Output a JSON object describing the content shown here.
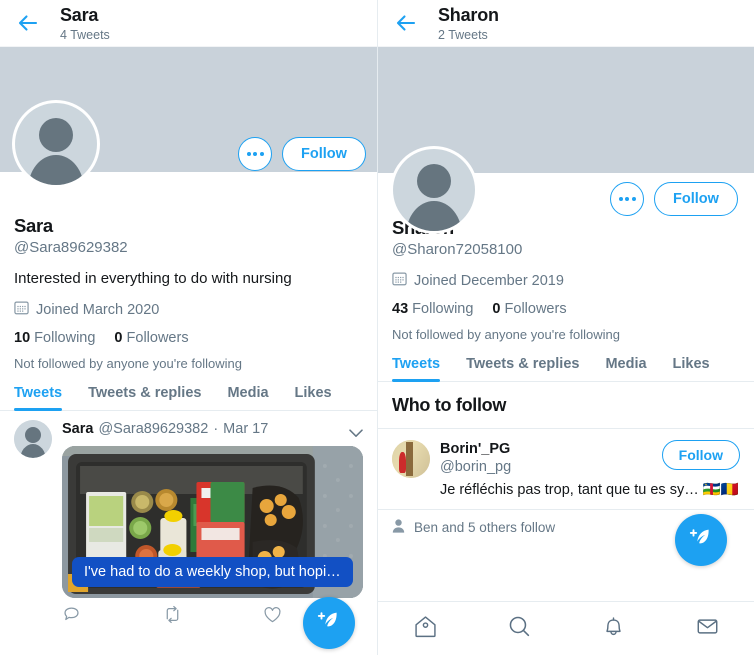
{
  "colors": {
    "accent": "#1da1f2",
    "banner": "#c9d2da",
    "text": "#14171a",
    "muted": "#657786",
    "caption_bg": "#1250c4",
    "avatar_bg": "#ccd6dd",
    "avatar_fg": "#66757f",
    "divider": "#e6ecf0"
  },
  "left": {
    "topbar": {
      "back_icon": "back-arrow-icon",
      "title": "Sara",
      "subtitle": "4 Tweets"
    },
    "profile": {
      "avatar_icon": "default-avatar-icon",
      "more_button_label": "•••",
      "follow_button_label": "Follow",
      "name": "Sara",
      "handle": "@Sara89629382",
      "bio": "Interested in everything to do with nursing",
      "joined_icon": "calendar-icon",
      "joined": "Joined March 2020",
      "following_count": "10",
      "following_label": "Following",
      "followers_count": "0",
      "followers_label": "Followers",
      "note": "Not followed by anyone you're following"
    },
    "tabs": [
      {
        "label": "Tweets",
        "active": true
      },
      {
        "label": "Tweets & replies",
        "active": false
      },
      {
        "label": "Media",
        "active": false
      },
      {
        "label": "Likes",
        "active": false
      }
    ],
    "tweet": {
      "avatar_icon": "default-avatar-icon",
      "name": "Sara",
      "handle": "@Sara89629382",
      "separator": "·",
      "date": "Mar 17",
      "chevron_icon": "chevron-down-icon",
      "photo_alt": "Plastic crate filled with groceries on pavement",
      "caption": "I've had to do a weekly shop, but hopi…",
      "actions": [
        {
          "icon": "reply-icon",
          "label": ""
        },
        {
          "icon": "retweet-icon",
          "label": ""
        },
        {
          "icon": "like-icon",
          "label": ""
        }
      ]
    },
    "fab": {
      "icon": "compose-tweet-icon"
    }
  },
  "right": {
    "topbar": {
      "back_icon": "back-arrow-icon",
      "title": "Sharon",
      "subtitle": "2 Tweets"
    },
    "profile": {
      "avatar_icon": "default-avatar-icon",
      "more_button_label": "•••",
      "follow_button_label": "Follow",
      "name": "Sharon",
      "handle": "@Sharon72058100",
      "joined_icon": "calendar-icon",
      "joined": "Joined December 2019",
      "following_count": "43",
      "following_label": "Following",
      "followers_count": "0",
      "followers_label": "Followers",
      "note": "Not followed by anyone you're following"
    },
    "tabs": [
      {
        "label": "Tweets",
        "active": true
      },
      {
        "label": "Tweets & replies",
        "active": false
      },
      {
        "label": "Media",
        "active": false
      },
      {
        "label": "Likes",
        "active": false
      }
    ],
    "who_to_follow": {
      "title": "Who to follow",
      "suggestion": {
        "avatar_alt": "Photo avatar, person in red against cream background",
        "name": "Borin'_PG",
        "handle": "@borin_pg",
        "bio": "Je réfléchis pas trop, tant que tu es sy… 🇨🇫🇷🇴",
        "follow_button_label": "Follow"
      },
      "footer_icon": "person-icon",
      "footer_text": "Ben and 5 others follow"
    },
    "bottom_nav": [
      {
        "icon": "home-icon",
        "label": "Home",
        "active": false
      },
      {
        "icon": "search-icon",
        "label": "Search",
        "active": false
      },
      {
        "icon": "notifications-bell-icon",
        "label": "Notifications",
        "active": false
      },
      {
        "icon": "messages-envelope-icon",
        "label": "Messages",
        "active": false
      }
    ],
    "fab": {
      "icon": "compose-tweet-icon"
    }
  }
}
